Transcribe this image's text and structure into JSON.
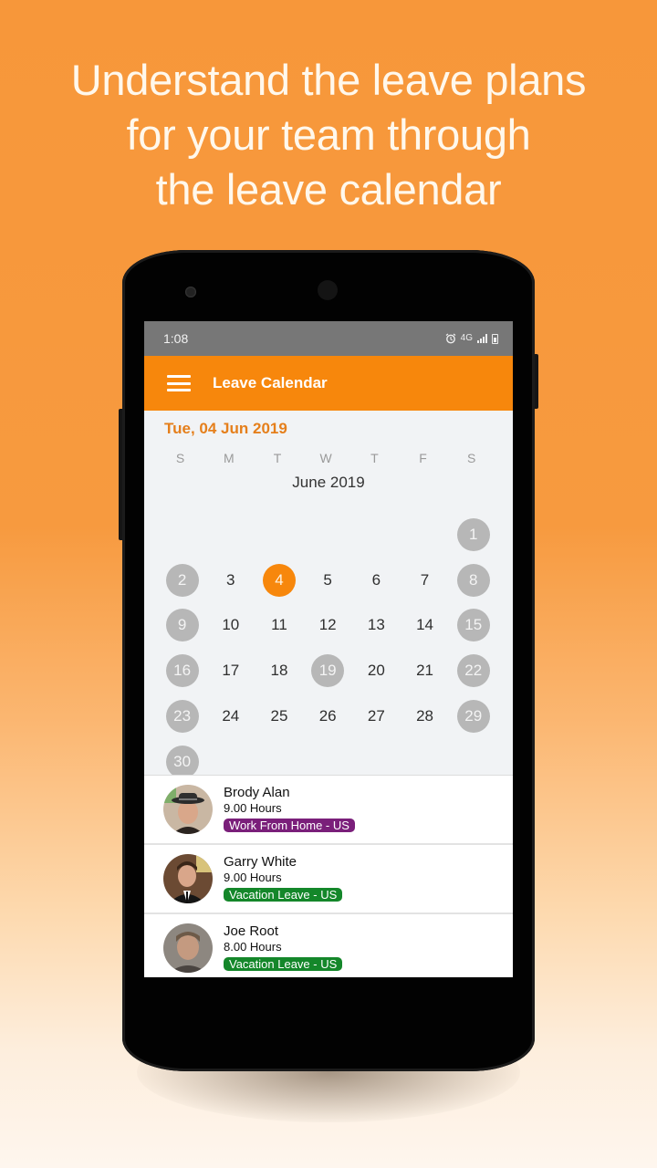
{
  "promo": {
    "headline_lines": [
      "Understand the leave plans",
      "for your team through",
      "the leave calendar"
    ]
  },
  "status_bar": {
    "time": "1:08",
    "network_label": "4G",
    "icons": [
      "alarm-icon",
      "network-4g-icon",
      "signal-icon",
      "battery-icon"
    ]
  },
  "app_bar": {
    "title": "Leave Calendar",
    "menu_icon": "hamburger-menu-icon",
    "color": "#f7870c"
  },
  "calendar": {
    "selected_date": "Tue, 04 Jun 2019",
    "weekdays": [
      "S",
      "M",
      "T",
      "W",
      "T",
      "F",
      "S"
    ],
    "month_label": "June 2019",
    "first_weekday_index": 6,
    "days_in_month": 30,
    "today": 4,
    "highlighted_days": [
      1,
      2,
      8,
      9,
      15,
      16,
      19,
      22,
      23,
      29,
      30
    ],
    "colors": {
      "today": "#f7870c",
      "highlighted": "#b7b7b7",
      "selected_date_text": "#e57f1b"
    }
  },
  "leaves": [
    {
      "name": "Brody Alan",
      "hours": "9.00 Hours",
      "type": "Work From Home - US",
      "badge_color": "#7a1f7a",
      "avatar": "avatar-brody-alan"
    },
    {
      "name": "Garry White",
      "hours": "9.00 Hours",
      "type": "Vacation Leave - US",
      "badge_color": "#14872a",
      "avatar": "avatar-garry-white"
    },
    {
      "name": "Joe Root",
      "hours": "8.00 Hours",
      "type": "Vacation Leave - US",
      "badge_color": "#14872a",
      "avatar": "avatar-joe-root"
    }
  ]
}
